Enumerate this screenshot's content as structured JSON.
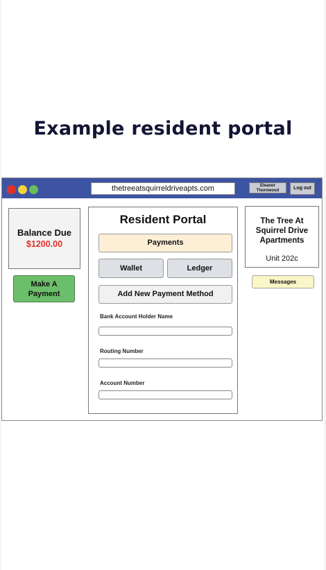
{
  "heading": "Example resident portal",
  "browser": {
    "url": "thetreeatsquirreldriveapts.com",
    "user_line1": "Eleanor",
    "user_line2": "Thornwood",
    "logout_label": "Log out"
  },
  "balance": {
    "label": "Balance Due",
    "amount": "$1200.00",
    "make_payment_line1": "Make A",
    "make_payment_line2": "Payment"
  },
  "portal": {
    "title": "Resident Portal",
    "payments_label": "Payments",
    "wallet_label": "Wallet",
    "ledger_label": "Ledger",
    "add_method_label": "Add New Payment Method",
    "fields": {
      "holder_label": "Bank Account Holder Name",
      "routing_label": "Routing Number",
      "account_label": "Account Number"
    }
  },
  "apartment": {
    "name_line1": "The Tree At",
    "name_line2": "Squirrel Drive",
    "name_line3": "Apartments",
    "unit": "Unit 202c",
    "messages_label": "Messages"
  },
  "colors": {
    "titlebar": "#3d54a3",
    "amount": "#e0312b",
    "make_payment": "#6cbf6a",
    "payments_tab": "#fdefd5",
    "messages": "#fbf6c8"
  }
}
